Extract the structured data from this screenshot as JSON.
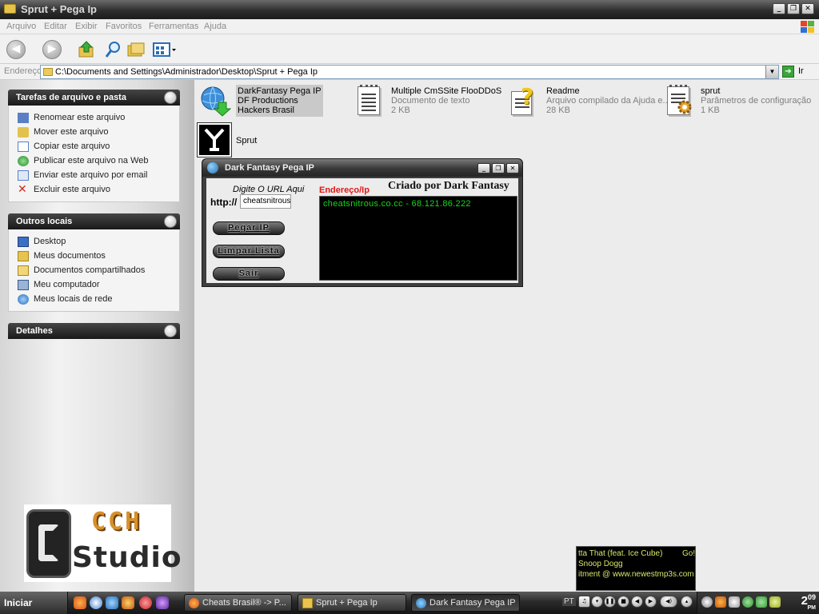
{
  "window": {
    "title": "Sprut + Pega Ip"
  },
  "menu": [
    "Arquivo",
    "Editar",
    "Exibir",
    "Favoritos",
    "Ferramentas",
    "Ajuda"
  ],
  "address": {
    "label": "Endereço",
    "path": "C:\\Documents and Settings\\Administrador\\Desktop\\Sprut + Pega Ip",
    "go_label": "Ir"
  },
  "sidebar": {
    "tasks": {
      "title": "Tarefas de arquivo e pasta",
      "items": [
        {
          "label": "Renomear este arquivo",
          "icon": "rename-icon"
        },
        {
          "label": "Mover este arquivo",
          "icon": "move-icon"
        },
        {
          "label": "Copiar este arquivo",
          "icon": "copy-icon"
        },
        {
          "label": "Publicar este arquivo na Web",
          "icon": "web-publish-icon"
        },
        {
          "label": "Enviar este arquivo por email",
          "icon": "email-icon"
        },
        {
          "label": "Excluir este arquivo",
          "icon": "delete-icon"
        }
      ]
    },
    "other": {
      "title": "Outros locais",
      "items": [
        {
          "label": "Desktop",
          "icon": "desktop-icon"
        },
        {
          "label": "Meus documentos",
          "icon": "my-documents-icon"
        },
        {
          "label": "Documentos compartilhados",
          "icon": "shared-folder-icon"
        },
        {
          "label": "Meu computador",
          "icon": "my-computer-icon"
        },
        {
          "label": "Meus locais de rede",
          "icon": "network-places-icon"
        }
      ]
    },
    "details": {
      "title": "Detalhes"
    }
  },
  "logo": {
    "top": "CCH",
    "bottom": "Studio"
  },
  "files": [
    {
      "name": "DarkFantasy Pega IP",
      "line2": "DF Productions",
      "line3": "Hackers Brasil",
      "icon": "globe-download-icon"
    },
    {
      "name": "Multiple CmSSite FlooDDoS",
      "line2": "Documento de texto",
      "line3": "2 KB",
      "icon": "text-document-icon"
    },
    {
      "name": "Readme",
      "line2": "Arquivo compilado da Ajuda e...",
      "line3": "28 KB",
      "icon": "help-file-icon"
    },
    {
      "name": "sprut",
      "line2": "Parâmetros de configuração",
      "line3": "1 KB",
      "icon": "config-file-icon"
    },
    {
      "name": "Sprut",
      "line2": "",
      "line3": "",
      "icon": "sprut-app-icon"
    }
  ],
  "app": {
    "title": "Dark Fantasy Pega IP",
    "prompt": "Digite O URL Aqui",
    "http_label": "http://",
    "url_value": "cheatsnitrous.co.cc",
    "buttons": {
      "get": "Pegar IP",
      "clear": "Limpar Lista",
      "exit": "Sair"
    },
    "list_header": "Endereço/Ip",
    "credit": "Criado por Dark Fantasy",
    "results": [
      "cheatsnitrous.co.cc - 68.121.86.222"
    ]
  },
  "media": {
    "line1": "tta That (feat. Ice Cube)",
    "line1b": "Go!",
    "line2": "Snoop Dogg",
    "line3": "itment @ www.newestmp3s.com"
  },
  "taskbar": {
    "start": "Iniciar",
    "tasks": [
      "Cheats Brasil® -> P...",
      "Sprut + Pega Ip",
      "Dark Fantasy Pega IP"
    ],
    "lang": "PT",
    "clock_hour": "2",
    "clock_min": "09",
    "clock_ampm": "PM"
  },
  "colors": {
    "title_dark": "#2e2e2e",
    "result_text": "#18d818",
    "list_header_red": "#e01818",
    "logo_orange": "#d6902c"
  }
}
